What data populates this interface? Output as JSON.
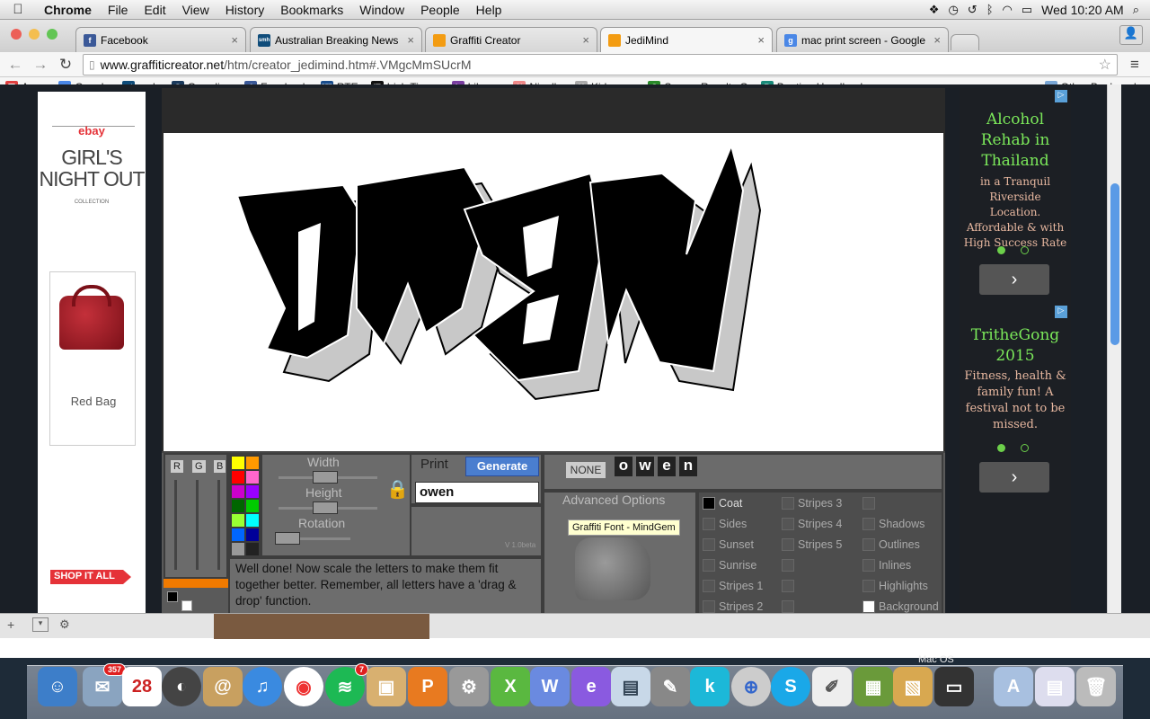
{
  "menubar": {
    "app": "Chrome",
    "items": [
      "File",
      "Edit",
      "View",
      "History",
      "Bookmarks",
      "Window",
      "People",
      "Help"
    ],
    "clock": "Wed 10:20 AM"
  },
  "tabs": [
    {
      "title": "Facebook",
      "fav": "f",
      "color": "#3b5998"
    },
    {
      "title": "Australian Breaking News",
      "fav": "smh",
      "color": "#0f4c7a"
    },
    {
      "title": "Graffiti Creator",
      "fav": "▮",
      "color": "#f39c12"
    },
    {
      "title": "JediMind",
      "fav": "▮",
      "color": "#f39c12",
      "active": true
    },
    {
      "title": "mac print screen - Google",
      "fav": "g",
      "color": "#4a87e6"
    }
  ],
  "url": {
    "domain": "www.graffiticreator.net",
    "path": "/htm/creator_jedimind.htm#.VMgcMmSUcrM"
  },
  "bookmarks": [
    {
      "label": "Apps",
      "icon": "▦",
      "color": "#e04040"
    },
    {
      "label": "Google",
      "icon": "g",
      "color": "#4a87e6"
    },
    {
      "label": "smh",
      "icon": "smh",
      "color": "#0f4c7a"
    },
    {
      "label": "Guardian",
      "icon": "G",
      "color": "#1b3a5c"
    },
    {
      "label": "Facebook",
      "icon": "f",
      "color": "#3b5998"
    },
    {
      "label": "RTE",
      "icon": "RTE",
      "color": "#1a4d8c"
    },
    {
      "label": "Irish Times",
      "icon": "IT",
      "color": "#111"
    },
    {
      "label": "Library",
      "icon": "L",
      "color": "#7a3fa0"
    },
    {
      "label": "Nigella",
      "icon": "N",
      "color": "#e88"
    },
    {
      "label": "Kidspace",
      "icon": "K",
      "color": "#aaa"
    },
    {
      "label": "Soccer Results O",
      "icon": "S",
      "color": "#2a8a2a"
    },
    {
      "label": "Boating Handbook",
      "icon": "B",
      "color": "#1a8a7a"
    }
  ],
  "other_bookmarks": "Other Bookmarks",
  "left_ad": {
    "brand": "ebay",
    "headline1": "GIRL'S",
    "headline2": "NIGHT OUT",
    "tagline": "COLLECTION",
    "product": "Red Bag",
    "cta": "SHOP IT ALL"
  },
  "right_ad1": {
    "title": "Alcohol Rehab in Thailand",
    "body": "in a Tranquil Riverside Location. Affordable & with High Success Rate"
  },
  "right_ad2": {
    "title": "TritheGong 2015",
    "body": "Fitness, health & family fun! A festival not to be missed."
  },
  "graffiti_text": "OWEN",
  "panel": {
    "rgb": [
      "R",
      "G",
      "B"
    ],
    "width_label": "Width",
    "height_label": "Height",
    "rotation_label": "Rotation",
    "print_label": "Print",
    "generate_label": "Generate",
    "input_value": "owen",
    "version": "V 1.0beta",
    "none_label": "NONE",
    "letters": [
      "o",
      "w",
      "e",
      "n"
    ],
    "advanced_label": "Advanced Options",
    "tooltip": "Graffiti Font - MindGem",
    "message": "Well done! Now scale the letters to make them fit together better. Remember, all letters have a 'drag & drop' function.",
    "options_col1": [
      "Coat",
      "Sides",
      "Sunset",
      "Sunrise",
      "Stripes 1",
      "Stripes 2"
    ],
    "options_col2": [
      "Stripes 3",
      "Stripes 4",
      "Stripes 5",
      "",
      ""
    ],
    "options_col3": [
      "",
      "Shadows",
      "Outlines",
      "Inlines",
      "Highlights",
      "Background"
    ]
  },
  "dock_labels": {
    "mac_os": "Mac OS",
    "calendar_day": "28",
    "mail_badge": "357",
    "spotify_badge": "7"
  }
}
